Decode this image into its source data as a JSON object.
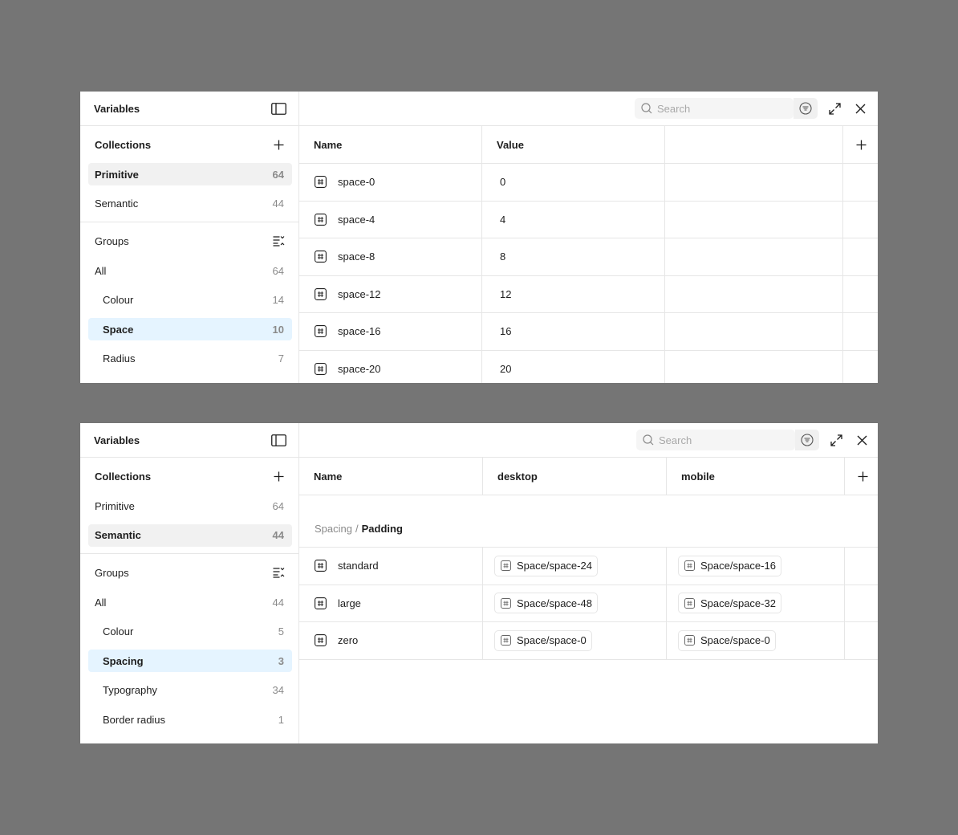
{
  "panel1": {
    "sidebar": {
      "title": "Variables",
      "collections_label": "Collections",
      "collections": [
        {
          "name": "Primitive",
          "count": "64"
        },
        {
          "name": "Semantic",
          "count": "44"
        }
      ],
      "groups_label": "Groups",
      "groups": [
        {
          "name": "All",
          "count": "64"
        },
        {
          "name": "Colour",
          "count": "14"
        },
        {
          "name": "Space",
          "count": "10"
        },
        {
          "name": "Radius",
          "count": "7"
        }
      ]
    },
    "search": {
      "placeholder": "Search"
    },
    "columns": [
      "Name",
      "Value",
      ""
    ],
    "rows": [
      {
        "name": "space-0",
        "value": "0"
      },
      {
        "name": "space-4",
        "value": "4"
      },
      {
        "name": "space-8",
        "value": "8"
      },
      {
        "name": "space-12",
        "value": "12"
      },
      {
        "name": "space-16",
        "value": "16"
      },
      {
        "name": "space-20",
        "value": "20"
      }
    ]
  },
  "panel2": {
    "sidebar": {
      "title": "Variables",
      "collections_label": "Collections",
      "collections": [
        {
          "name": "Primitive",
          "count": "64"
        },
        {
          "name": "Semantic",
          "count": "44"
        }
      ],
      "groups_label": "Groups",
      "groups": [
        {
          "name": "All",
          "count": "44"
        },
        {
          "name": "Colour",
          "count": "5"
        },
        {
          "name": "Spacing",
          "count": "3"
        },
        {
          "name": "Typography",
          "count": "34"
        },
        {
          "name": "Border radius",
          "count": "1"
        }
      ]
    },
    "search": {
      "placeholder": "Search"
    },
    "columns": [
      "Name",
      "desktop",
      "mobile"
    ],
    "group_path": {
      "parent": "Spacing",
      "separator": "/",
      "current": "Padding"
    },
    "rows": [
      {
        "name": "standard",
        "desktop": "Space/space-24",
        "mobile": "Space/space-16"
      },
      {
        "name": "large",
        "desktop": "Space/space-48",
        "mobile": "Space/space-32"
      },
      {
        "name": "zero",
        "desktop": "Space/space-0",
        "mobile": "Space/space-0"
      }
    ]
  },
  "colors": {
    "backdrop": "#757575",
    "selected_group_bg": "#e5f4ff",
    "active_collection_bg": "#f1f1f1",
    "border": "#e6e6e6"
  }
}
